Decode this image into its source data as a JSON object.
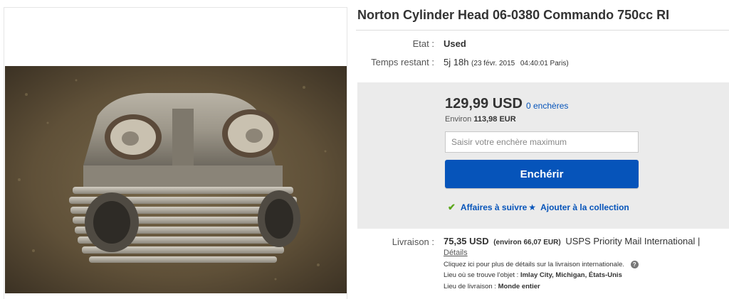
{
  "listing": {
    "title": "Norton Cylinder Head 06-0380 Commando 750cc RI"
  },
  "condition": {
    "label": "Etat :",
    "value": "Used"
  },
  "time_left": {
    "label": "Temps restant :",
    "value": "5j 18h",
    "end_date": "(23 févr. 2015",
    "end_time": "04:40:01 Paris)"
  },
  "bid": {
    "price": "129,99 USD",
    "bids_count": "0 enchères",
    "approx_prefix": "Environ",
    "approx_value": "113,98 EUR",
    "input_placeholder": "Saisir votre enchère maximum",
    "button_label": "Enchérir",
    "watch_label": "Affaires à suivre",
    "collection_label": "Ajouter à la collection"
  },
  "shipping": {
    "label": "Livraison :",
    "price": "75,35 USD",
    "approx": "(environ 66,07 EUR)",
    "service": "USPS Priority Mail International |",
    "details_link": "Détails",
    "intl_note": "Cliquez ici pour plus de détails sur la livraison internationale.",
    "location_label": "Lieu où se trouve l'objet :",
    "location_value": "Imlay City, Michigan, États-Unis",
    "ships_to_label": "Lieu de livraison :",
    "ships_to_value": "Monde entier"
  },
  "colors": {
    "accent_blue": "#0654ba",
    "check_green": "#5ba71b",
    "bid_box_bg": "#ebebeb"
  },
  "icons": [
    "checkmark-icon",
    "star-icon",
    "help-icon"
  ]
}
